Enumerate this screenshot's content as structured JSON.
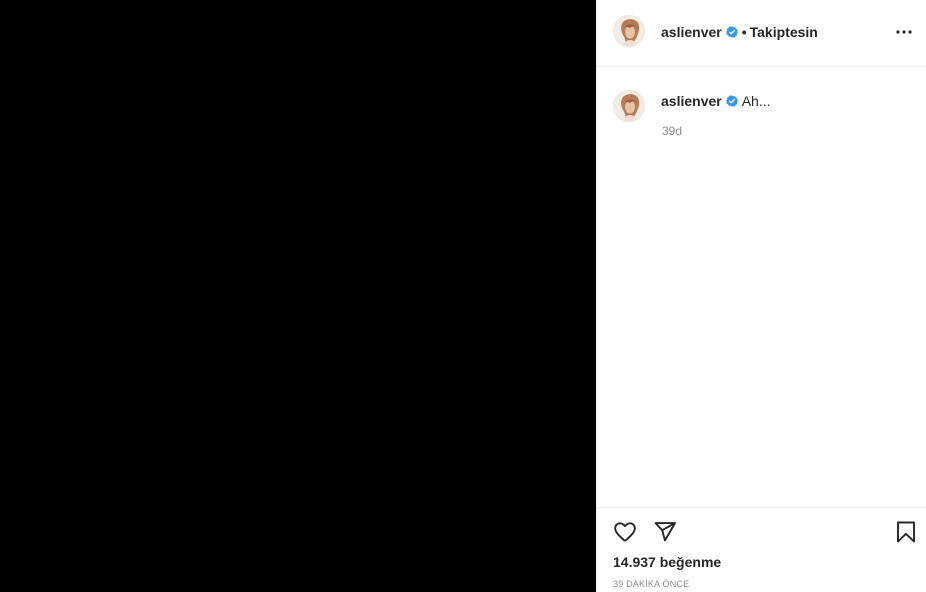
{
  "post": {
    "media": {
      "background": "#000000"
    },
    "header": {
      "username": "aslienver",
      "verified": true,
      "separator": "•",
      "follow_status": "Takiptesin",
      "more_icon": "more-horizontal-icon"
    },
    "caption": {
      "username": "aslienver",
      "text": "Ah...",
      "time": "39d"
    },
    "actions": {
      "like_icon": "heart-outline-icon",
      "share_icon": "paper-plane-icon",
      "save_icon": "bookmark-outline-icon"
    },
    "likes": "14.937 beğenme",
    "timestamp": "39 DAKİKA ÖNCE"
  },
  "colors": {
    "verified_badge": "#3897f0",
    "text_primary": "#262626",
    "text_secondary": "#8e8e8e",
    "divider": "#efefef"
  }
}
